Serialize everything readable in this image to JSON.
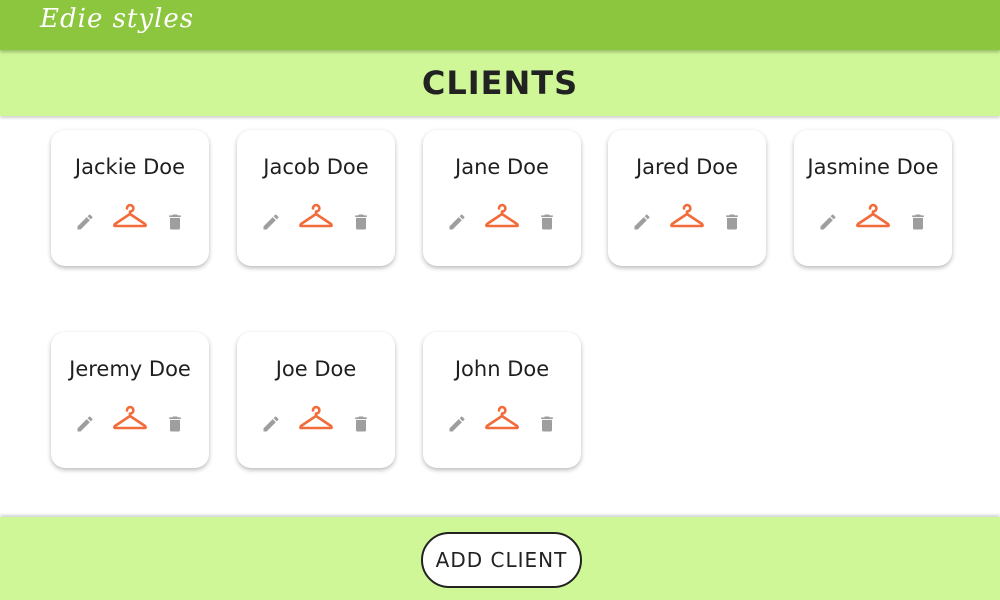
{
  "header": {
    "logo_text": "Edie styles"
  },
  "page": {
    "title": "CLIENTS"
  },
  "clients": [
    {
      "name": "Jackie Doe"
    },
    {
      "name": "Jacob Doe"
    },
    {
      "name": "Jane Doe"
    },
    {
      "name": "Jared Doe"
    },
    {
      "name": "Jasmine Doe"
    },
    {
      "name": "Jeremy Doe"
    },
    {
      "name": "Joe Doe"
    },
    {
      "name": "John Doe"
    }
  ],
  "card_icons": {
    "edit": "pencil-icon",
    "wardrobe": "hanger-icon",
    "delete": "trash-icon"
  },
  "footer": {
    "add_button_label": "ADD CLIENT"
  },
  "colors": {
    "top_bar": "#8cc63f",
    "title_bar": "#cff797",
    "hanger": "#f26b3a",
    "action_icons": "#9e9e9e"
  }
}
